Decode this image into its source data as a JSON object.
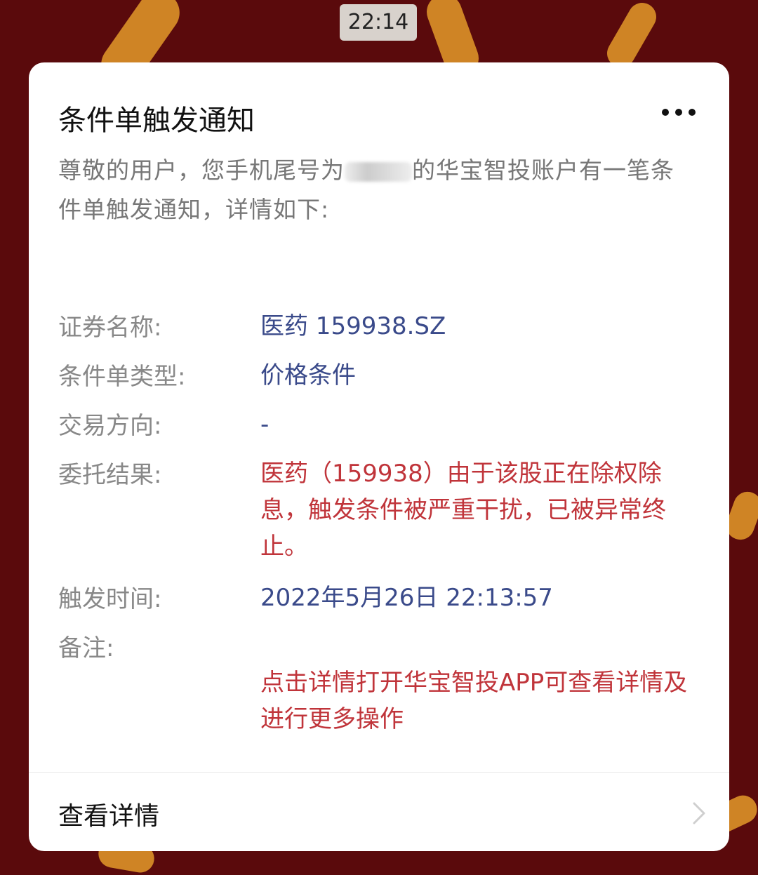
{
  "status_time": "22:14",
  "card": {
    "title": "条件单触发通知",
    "intro_before": "尊敬的用户，您手机尾号为",
    "intro_after": "的华宝智投账户有一笔条件单触发通知，详情如下:",
    "fields": [
      {
        "label": "证券名称:",
        "value": "医药 159938.SZ",
        "tone": "blue"
      },
      {
        "label": "条件单类型:",
        "value": "价格条件",
        "tone": "blue"
      },
      {
        "label": "交易方向:",
        "value": "-",
        "tone": "blue"
      },
      {
        "label": "委托结果:",
        "value": "医药（159938）由于该股正在除权除息，触发条件被严重干扰，已被异常终止。",
        "tone": "red"
      },
      {
        "label": "触发时间:",
        "value": "2022年5月26日 22:13:57",
        "tone": "blue"
      },
      {
        "label": "备注:",
        "value": "点击详情打开华宝智投APP可查看详情及进行更多操作",
        "tone": "red"
      }
    ],
    "footer_link": "查看详情"
  },
  "icons": {
    "more": "more-horizontal-icon",
    "chevron": "chevron-right-icon"
  },
  "colors": {
    "background": "#5a0a0c",
    "accent_blue": "#3a4a8a",
    "accent_red": "#c0343a"
  }
}
